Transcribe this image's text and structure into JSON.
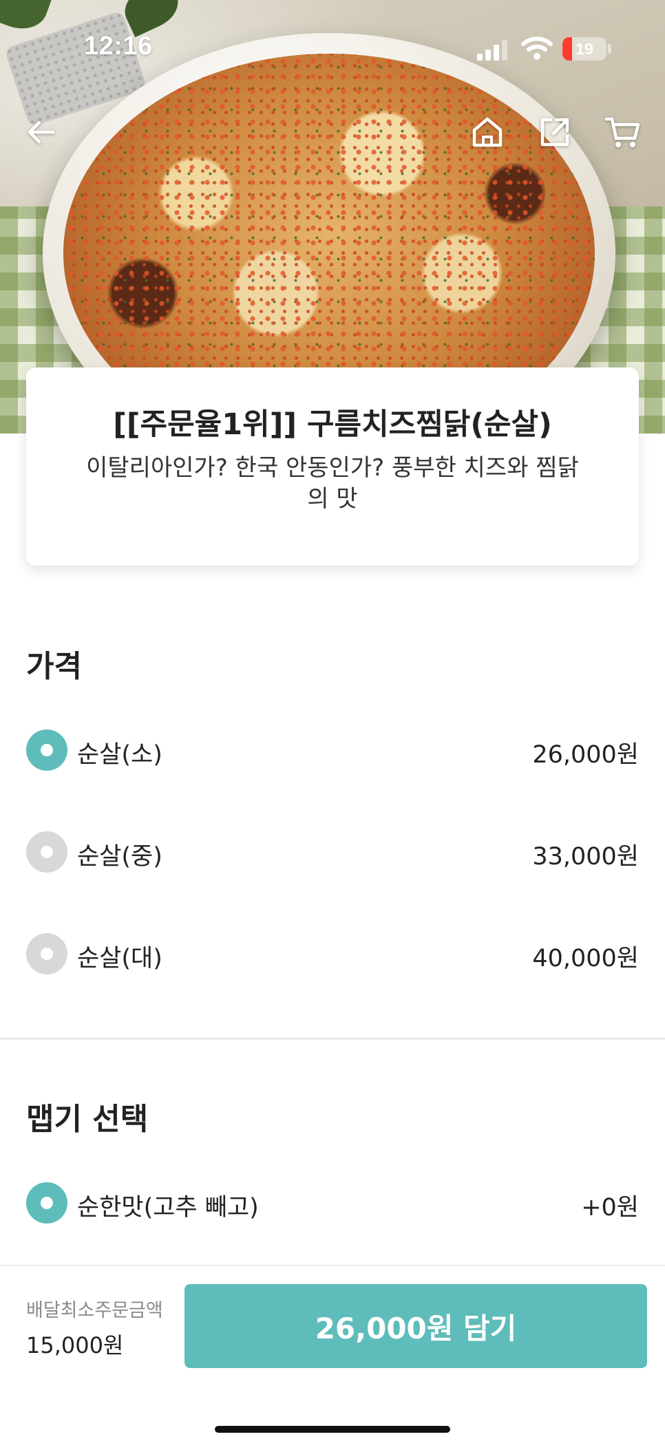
{
  "status_bar": {
    "time": "12:16",
    "battery": "19"
  },
  "nav": {
    "back_icon": "arrow-left-icon",
    "home_icon": "home-icon",
    "share_icon": "share-icon",
    "cart_icon": "cart-icon"
  },
  "product": {
    "title": "[[주문율1위]] 구름치즈찜닭(순살)",
    "description": "이탈리아인가? 한국 안동인가? 풍부한 치즈와 찜닭의 맛"
  },
  "price_section": {
    "title": "가격",
    "options": [
      {
        "label": "순살(소)",
        "price": "26,000원",
        "selected": true
      },
      {
        "label": "순살(중)",
        "price": "33,000원",
        "selected": false
      },
      {
        "label": "순살(대)",
        "price": "40,000원",
        "selected": false
      }
    ]
  },
  "spice_section": {
    "title": "맵기 선택",
    "options": [
      {
        "label": "순한맛(고추 빼고)",
        "price": "+0원",
        "selected": true
      }
    ]
  },
  "bottom_bar": {
    "min_order_label": "배달최소주문금액",
    "min_order_value": "15,000원",
    "add_button_label": "26,000원 담기"
  },
  "colors": {
    "accent": "#5ebdba",
    "radio_off": "#d8d8d8",
    "text": "#222222",
    "muted": "#8a8a8a"
  }
}
